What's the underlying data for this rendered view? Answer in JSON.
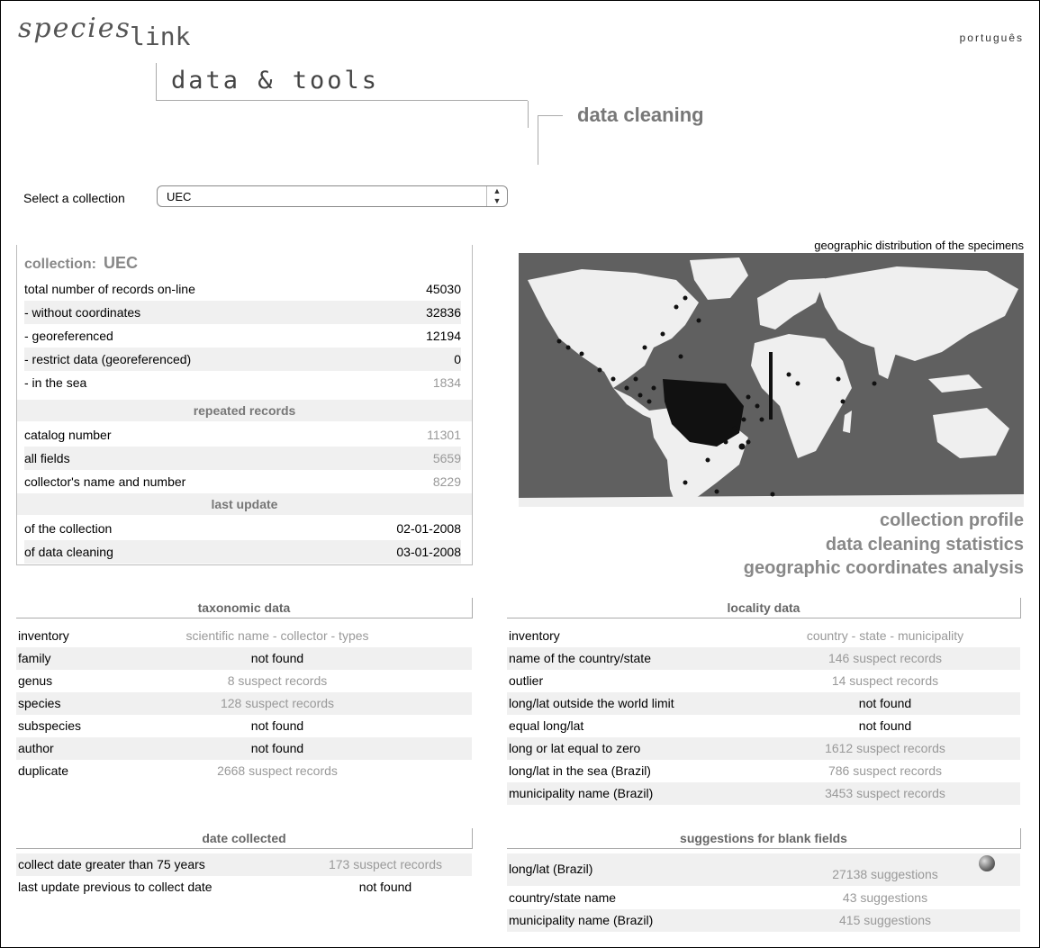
{
  "header": {
    "logo_left": "species",
    "logo_right": "link",
    "language_link": "português",
    "section_title": "data & tools",
    "subsection_title": "data cleaning"
  },
  "collection_select": {
    "label": "Select a collection",
    "selected": "UEC"
  },
  "collection_summary": {
    "label": "collection:",
    "name": "UEC",
    "rows": [
      {
        "label": "total number of records on-line",
        "value": "45030"
      },
      {
        "label": "- without coordinates",
        "value": "32836"
      },
      {
        "label": "- georeferenced",
        "value": "12194"
      },
      {
        "label": "- restrict data (georeferenced)",
        "value": "0"
      },
      {
        "label": "- in the sea",
        "value": "1834"
      }
    ],
    "repeated_title": "repeated records",
    "repeated": [
      {
        "label": "catalog number",
        "value": "11301"
      },
      {
        "label": "all fields",
        "value": "5659"
      },
      {
        "label": "collector's name and number",
        "value": "8229"
      }
    ],
    "update_title": "last update",
    "updates": [
      {
        "label": "of the collection",
        "value": "02-01-2008"
      },
      {
        "label": "of data cleaning",
        "value": "03-01-2008"
      }
    ]
  },
  "map": {
    "caption": "geographic distribution of the specimens"
  },
  "side_links": {
    "profile": "collection profile",
    "statistics": "data cleaning statistics",
    "analysis": "geographic coordinates analysis"
  },
  "taxonomic": {
    "title": "taxonomic data",
    "rows": [
      {
        "label": "inventory",
        "value": "scientific name - collector - types"
      },
      {
        "label": "family",
        "value": "not found"
      },
      {
        "label": "genus",
        "value": "8 suspect records"
      },
      {
        "label": "species",
        "value": "128 suspect records"
      },
      {
        "label": "subspecies",
        "value": "not found"
      },
      {
        "label": "author",
        "value": "not found"
      },
      {
        "label": "duplicate",
        "value": "2668 suspect records"
      }
    ]
  },
  "locality": {
    "title": "locality data",
    "rows": [
      {
        "label": "inventory",
        "value": "country - state - municipality"
      },
      {
        "label": "name of the country/state",
        "value": "146 suspect records"
      },
      {
        "label": "outlier",
        "value": "14 suspect records"
      },
      {
        "label": "long/lat outside the world limit",
        "value": "not found"
      },
      {
        "label": "equal long/lat",
        "value": "not found"
      },
      {
        "label": "long or lat equal to zero",
        "value": "1612 suspect records"
      },
      {
        "label": "long/lat in the sea (Brazil)",
        "value": "786 suspect records"
      },
      {
        "label": "municipality name (Brazil)",
        "value": "3453 suspect records"
      }
    ]
  },
  "date_collected": {
    "title": "date collected",
    "rows": [
      {
        "label": "collect date greater than 75 years",
        "value": "173 suspect records"
      },
      {
        "label": "last update previous to collect date",
        "value": "not found"
      }
    ]
  },
  "suggestions": {
    "title": "suggestions for blank fields",
    "rows": [
      {
        "label": "long/lat (Brazil)",
        "value": "27138 suggestions"
      },
      {
        "label": "country/state name",
        "value": "43 suggestions"
      },
      {
        "label": "municipality name (Brazil)",
        "value": "415 suggestions"
      }
    ]
  }
}
